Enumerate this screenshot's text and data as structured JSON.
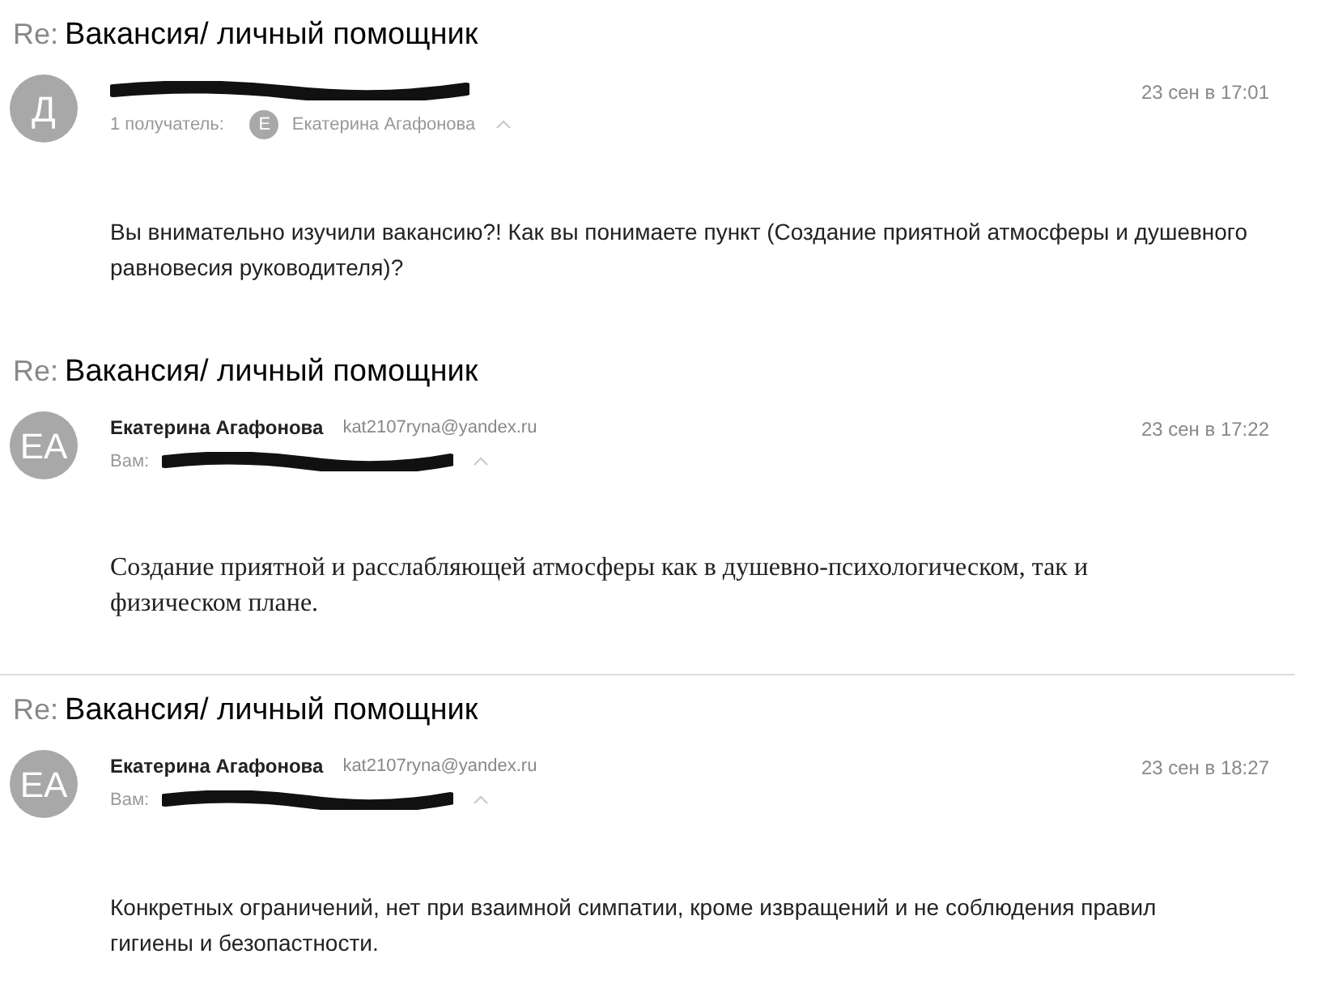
{
  "messages": [
    {
      "kind": "sans",
      "subject_prefix": "Re:",
      "subject": "Вакансия/ личный помощник",
      "avatar": "Д",
      "recipients_label": "1 получатель:",
      "recipient_avatar": "Е",
      "recipient": "Екатерина Агафонова",
      "date": "23 сен в 17:01",
      "body": [
        "Вы внимательно изучили вакансию?! Как вы понимаете пункт (Создание приятной атмосферы и душевного",
        "равновесия руководителя)?"
      ]
    },
    {
      "kind": "serif",
      "subject_prefix": "Re:",
      "subject": "Вакансия/ личный помощник",
      "avatar": "EA",
      "sender": "Екатерина Агафонова",
      "email": "kat2107ryna@yandex.ru",
      "recipients_label": "Вам:",
      "date": "23 сен в 17:22",
      "body": [
        "Создание приятной и расслабляющей атмосферы как в душевно-психологическом, так и",
        "физическом плане."
      ]
    },
    {
      "kind": "divider"
    },
    {
      "kind": "sans",
      "subject_prefix": "Re:",
      "subject": "Вакансия/ личный помощник",
      "avatar": "EA",
      "sender": "Екатерина Агафонова",
      "email": "kat2107ryna@yandex.ru",
      "recipients_label": "Вам:",
      "date": "23 сен в 18:27",
      "body": [
        "Конкретных ограничений, нет при взаимной симпатии, кроме извращений и не соблюдения правил",
        "гигиены и безопастности."
      ]
    }
  ]
}
